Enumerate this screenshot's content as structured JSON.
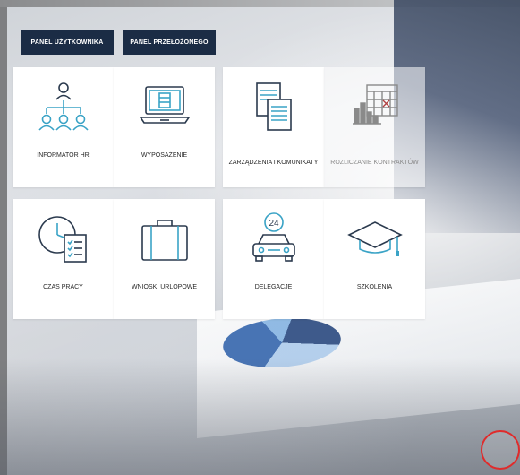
{
  "buttons": {
    "user_panel": "PANEL UŻYTKOWNIKA",
    "manager_panel": "PANEL PRZEŁOŻONEGO"
  },
  "tiles": [
    {
      "label": "INFORMATOR HR",
      "icon": "org-chart-icon"
    },
    {
      "label": "WYPOSAŻENIE",
      "icon": "laptop-icon"
    },
    {
      "label": "ZARZĄDZENIA I KOMUNIKATY",
      "icon": "documents-icon"
    },
    {
      "label": "ROZLICZANIE KONTRAKTÓW",
      "icon": "calendar-chart-icon"
    },
    {
      "label": "CZAS PRACY",
      "icon": "clock-checklist-icon"
    },
    {
      "label": "WNIOSKI URLOPOWE",
      "icon": "suitcase-icon"
    },
    {
      "label": "DELEGACJE",
      "icon": "car-24-icon"
    },
    {
      "label": "SZKOLENIA",
      "icon": "graduation-cap-icon"
    }
  ],
  "colors": {
    "button_bg": "#1b2c45",
    "icon_teal": "#3aa3c6",
    "icon_dark": "#2b3a4e",
    "notification_ring": "#e02b2b"
  }
}
